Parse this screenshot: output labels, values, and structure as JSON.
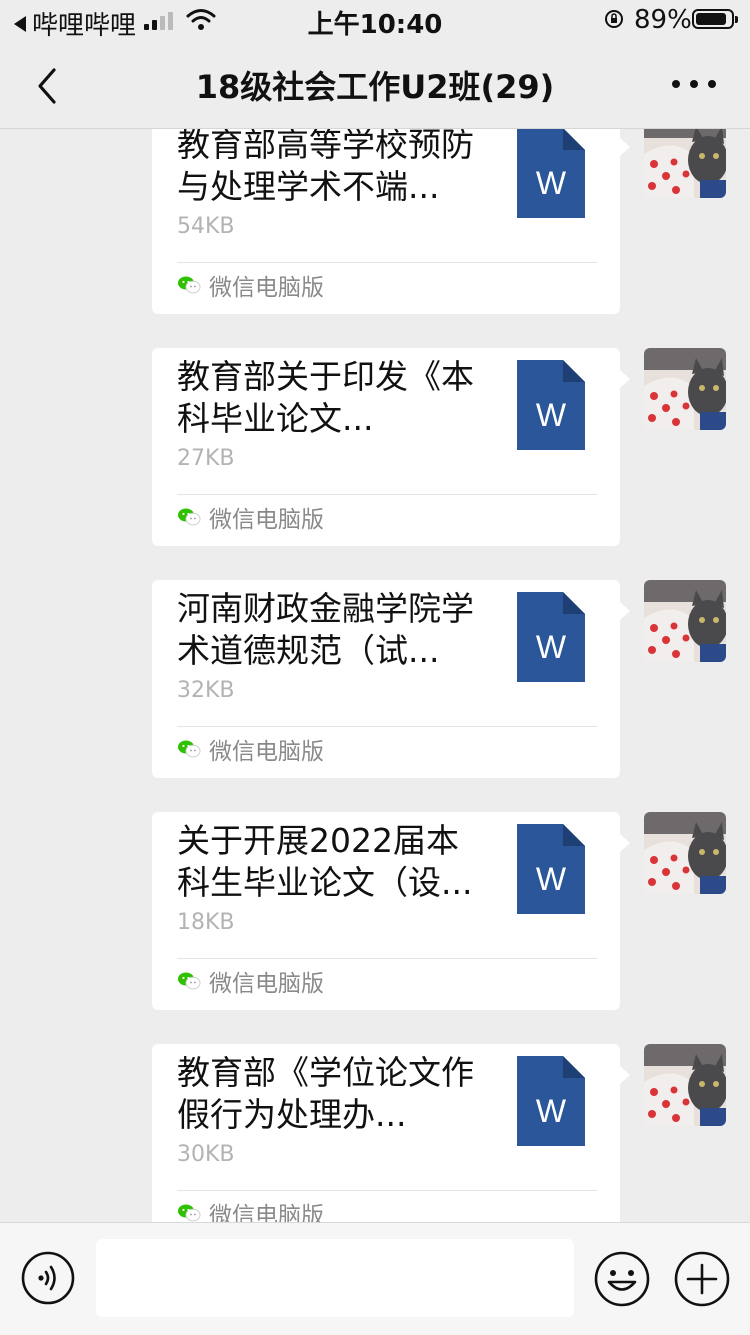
{
  "status_bar": {
    "back_app": "哔哩哔哩",
    "time": "上午10:40",
    "battery": "89%",
    "battery_level": 0.89
  },
  "header": {
    "title": "18级社会工作U2班(29)"
  },
  "messages": [
    {
      "file_name": "教育部高等学校预防与处理学术不端...",
      "size": "54KB",
      "source": "微信电脑版"
    },
    {
      "file_name": "教育部关于印发《本科毕业论文...",
      "size": "27KB",
      "source": "微信电脑版"
    },
    {
      "file_name": "河南财政金融学院学术道德规范（试...",
      "size": "32KB",
      "source": "微信电脑版"
    },
    {
      "file_name": "关于开展2022届本科生毕业论文（设...",
      "size": "18KB",
      "source": "微信电脑版"
    },
    {
      "file_name": "教育部《学位论文作假行为处理办...",
      "size": "30KB",
      "source": "微信电脑版"
    }
  ],
  "file_icon_letter": "W",
  "colors": {
    "word_blue": "#2b579a",
    "background": "#ededed"
  },
  "icons": {
    "back": "chevron-left-icon",
    "more": "more-icon",
    "voice": "voice-icon",
    "emoji": "emoji-icon",
    "plus": "plus-icon",
    "file": "word-file-icon",
    "source": "wechat-icon"
  }
}
